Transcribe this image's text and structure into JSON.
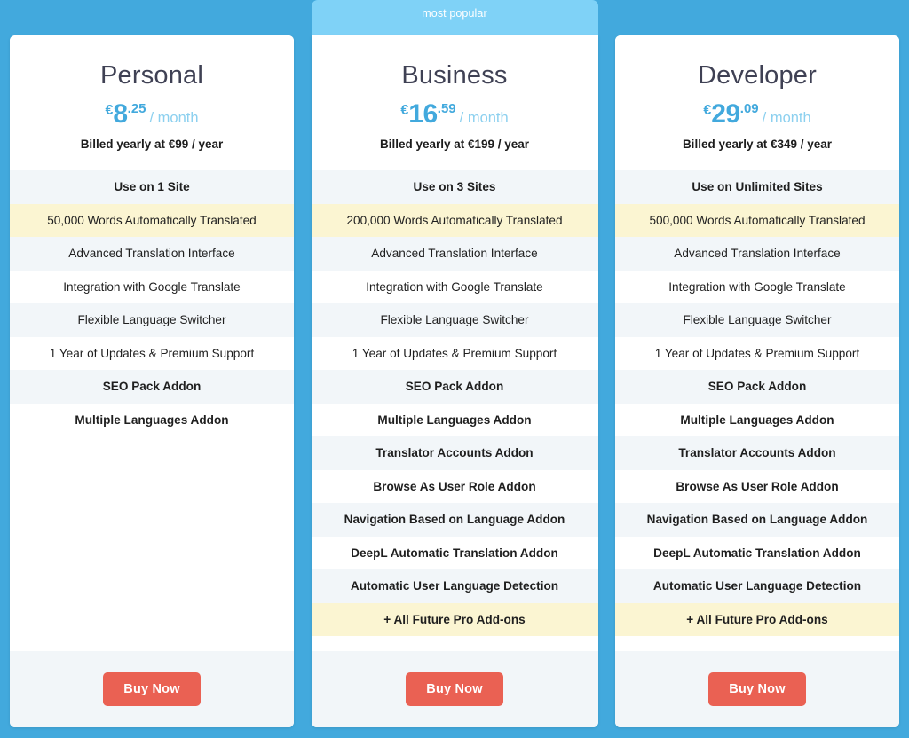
{
  "theme": {
    "page_background": "#42a9dd",
    "banner_background": "#7fd2f7",
    "card_background": "#ffffff",
    "stripe_background": "#f2f6f9",
    "highlight_background": "#fbf5d2",
    "accent_price": "#42a9dd",
    "accent_price_muted": "#8cd0ef",
    "buy_button": "#ea6153",
    "title_color": "#3f4154"
  },
  "badge": {
    "most_popular_label": "most popular"
  },
  "plans": [
    {
      "name": "Personal",
      "currency_symbol": "€",
      "price_whole": "8",
      "price_cents": ".25",
      "per_period": "/ month",
      "billed_note": "Billed yearly at €99 / year",
      "featured": false,
      "buy_label": "Buy Now",
      "features": [
        {
          "label": "Use on 1 Site",
          "style": "shade",
          "bold": true
        },
        {
          "label": "50,000 Words Automatically Translated",
          "style": "hl",
          "bold": false
        },
        {
          "label": "Advanced Translation Interface",
          "style": "shade",
          "bold": false
        },
        {
          "label": "Integration with Google Translate",
          "style": "plain",
          "bold": false
        },
        {
          "label": "Flexible Language Switcher",
          "style": "shade",
          "bold": false
        },
        {
          "label": "1 Year of Updates & Premium Support",
          "style": "plain",
          "bold": false
        },
        {
          "label": "SEO Pack Addon",
          "style": "shade",
          "bold": true
        },
        {
          "label": "Multiple Languages Addon",
          "style": "plain",
          "bold": true
        }
      ]
    },
    {
      "name": "Business",
      "currency_symbol": "€",
      "price_whole": "16",
      "price_cents": ".59",
      "per_period": "/ month",
      "billed_note": "Billed yearly at €199 / year",
      "featured": true,
      "buy_label": "Buy Now",
      "features": [
        {
          "label": "Use on 3 Sites",
          "style": "shade",
          "bold": true
        },
        {
          "label": "200,000 Words Automatically Translated",
          "style": "hl",
          "bold": false
        },
        {
          "label": "Advanced Translation Interface",
          "style": "shade",
          "bold": false
        },
        {
          "label": "Integration with Google Translate",
          "style": "plain",
          "bold": false
        },
        {
          "label": "Flexible Language Switcher",
          "style": "shade",
          "bold": false
        },
        {
          "label": "1 Year of Updates & Premium Support",
          "style": "plain",
          "bold": false
        },
        {
          "label": "SEO Pack Addon",
          "style": "shade",
          "bold": true
        },
        {
          "label": "Multiple Languages Addon",
          "style": "plain",
          "bold": true
        },
        {
          "label": "Translator Accounts Addon",
          "style": "shade",
          "bold": true
        },
        {
          "label": "Browse As User Role Addon",
          "style": "plain",
          "bold": true
        },
        {
          "label": "Navigation Based on Language Addon",
          "style": "shade",
          "bold": true
        },
        {
          "label": "DeepL Automatic Translation Addon",
          "style": "plain",
          "bold": true
        },
        {
          "label": "Automatic User Language Detection",
          "style": "shade",
          "bold": true
        },
        {
          "label": "+ All Future Pro Add-ons",
          "style": "hl",
          "bold": true
        }
      ]
    },
    {
      "name": "Developer",
      "currency_symbol": "€",
      "price_whole": "29",
      "price_cents": ".09",
      "per_period": "/ month",
      "billed_note": "Billed yearly at €349 / year",
      "featured": false,
      "buy_label": "Buy Now",
      "features": [
        {
          "label": "Use on Unlimited Sites",
          "style": "shade",
          "bold": true
        },
        {
          "label": "500,000 Words Automatically Translated",
          "style": "hl",
          "bold": false
        },
        {
          "label": "Advanced Translation Interface",
          "style": "shade",
          "bold": false
        },
        {
          "label": "Integration with Google Translate",
          "style": "plain",
          "bold": false
        },
        {
          "label": "Flexible Language Switcher",
          "style": "shade",
          "bold": false
        },
        {
          "label": "1 Year of Updates & Premium Support",
          "style": "plain",
          "bold": false
        },
        {
          "label": "SEO Pack Addon",
          "style": "shade",
          "bold": true
        },
        {
          "label": "Multiple Languages Addon",
          "style": "plain",
          "bold": true
        },
        {
          "label": "Translator Accounts Addon",
          "style": "shade",
          "bold": true
        },
        {
          "label": "Browse As User Role Addon",
          "style": "plain",
          "bold": true
        },
        {
          "label": "Navigation Based on Language Addon",
          "style": "shade",
          "bold": true
        },
        {
          "label": "DeepL Automatic Translation Addon",
          "style": "plain",
          "bold": true
        },
        {
          "label": "Automatic User Language Detection",
          "style": "shade",
          "bold": true
        },
        {
          "label": "+ All Future Pro Add-ons",
          "style": "hl",
          "bold": true
        }
      ]
    }
  ]
}
